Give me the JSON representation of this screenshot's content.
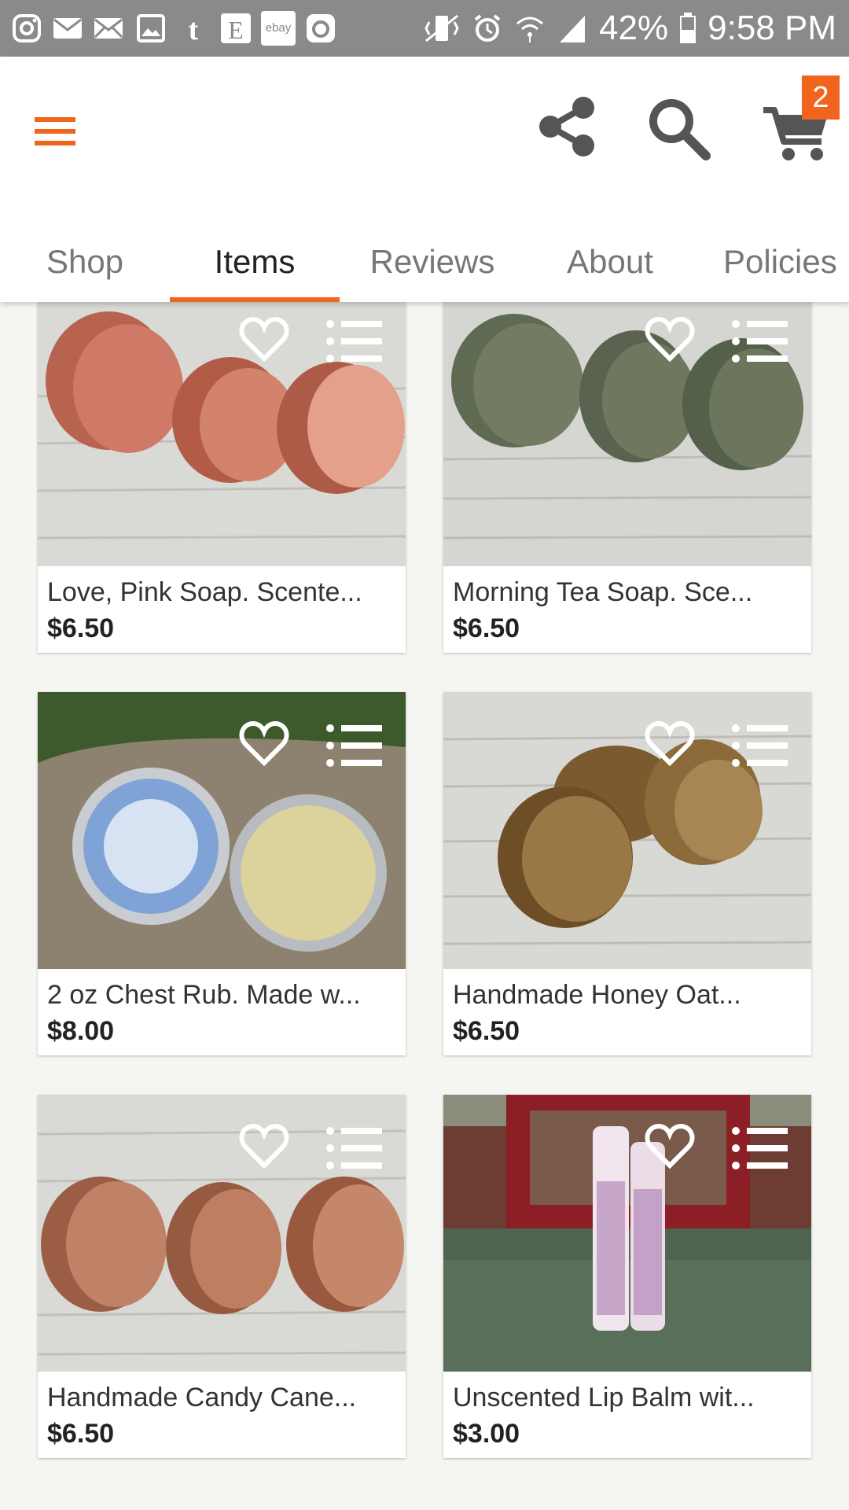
{
  "status_bar": {
    "battery": "42%",
    "time": "9:58 PM",
    "left_icons": [
      "instagram-icon",
      "mail-icon",
      "mail-icon",
      "image-icon",
      "tumblr-icon",
      "etsy-icon",
      "ebay-icon",
      "camera-icon"
    ]
  },
  "header": {
    "cart_count": "2",
    "accent": "#f1641e"
  },
  "tabs": [
    {
      "label": "Shop"
    },
    {
      "label": "Items"
    },
    {
      "label": "Reviews"
    },
    {
      "label": "About"
    },
    {
      "label": "Policies"
    }
  ],
  "active_tab": "Items",
  "items": [
    {
      "title": "Love, Pink Soap. Scente...",
      "price": "$6.50"
    },
    {
      "title": "Morning Tea Soap. Sce...",
      "price": "$6.50"
    },
    {
      "title": "2 oz Chest Rub. Made w...",
      "price": "$8.00"
    },
    {
      "title": "Handmade Honey Oat...",
      "price": "$6.50"
    },
    {
      "title": "Handmade Candy Cane...",
      "price": "$6.50"
    },
    {
      "title": "Unscented Lip Balm wit...",
      "price": "$3.00"
    }
  ],
  "ebay_label": "ebay"
}
